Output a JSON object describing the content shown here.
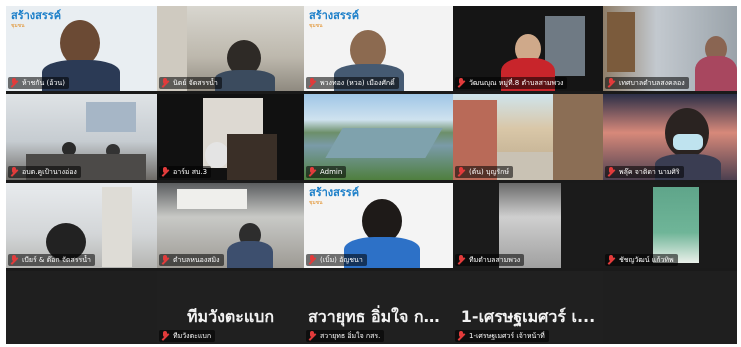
{
  "colors": {
    "active_border": "#d6e21a",
    "mic_muted": "#e23b3b",
    "tile_bg": "#202020",
    "logo_blue": "#1c7fc9"
  },
  "tiles": [
    {
      "name": "ห้าชกัน (อ้วน)",
      "logo": "สร้างสรรค์",
      "logo_sub": "ชุมชน"
    },
    {
      "name": "นิตย์ จัดสรรน้ำ"
    },
    {
      "name": "พวงทอง (หวอ) เมืองศักดิ์",
      "logo": "สร้างสรรค์",
      "logo_sub": "ชุมชน"
    },
    {
      "name": "วัฒนญุณ หมู่ที่.8 ตำบลสามพวง"
    },
    {
      "name": "เทศบาลตำบลสงคลอง"
    },
    {
      "name": "อบต.คูเป้านางอ่อง"
    },
    {
      "name": "อาร์ม สบ.3"
    },
    {
      "name": "Admin"
    },
    {
      "name": "(ต้น) บุญรักษ์"
    },
    {
      "name": "พลุ๊ค จาติดา นามศิริ"
    },
    {
      "name": "เบียร์ & ต๊อก จัดสรรน้ำ"
    },
    {
      "name": "ตำบลหนองสมิง"
    },
    {
      "name": "(เบิ้ม) อัญชนา",
      "logo": "สร้างสรรค์",
      "logo_sub": "ชุมชน"
    },
    {
      "name": "ทีมตำบลสามพวง"
    },
    {
      "name": "ชัชญวัฒน์ แก้วทิพ"
    },
    {
      "name": ""
    },
    {
      "name": "ทีมวังตะแบก",
      "big": "ทีมวังตะแบก"
    },
    {
      "name": "สวายุทธ อิ่มใจ กสร.",
      "big": "สวายุทธ อิ่มใจ กส..."
    },
    {
      "name": "1-เศรษฐเมศวร์ เจ้าหน้าที่",
      "big": "1-เศรษฐเมศวร์ เ..."
    },
    {
      "name": ""
    }
  ]
}
